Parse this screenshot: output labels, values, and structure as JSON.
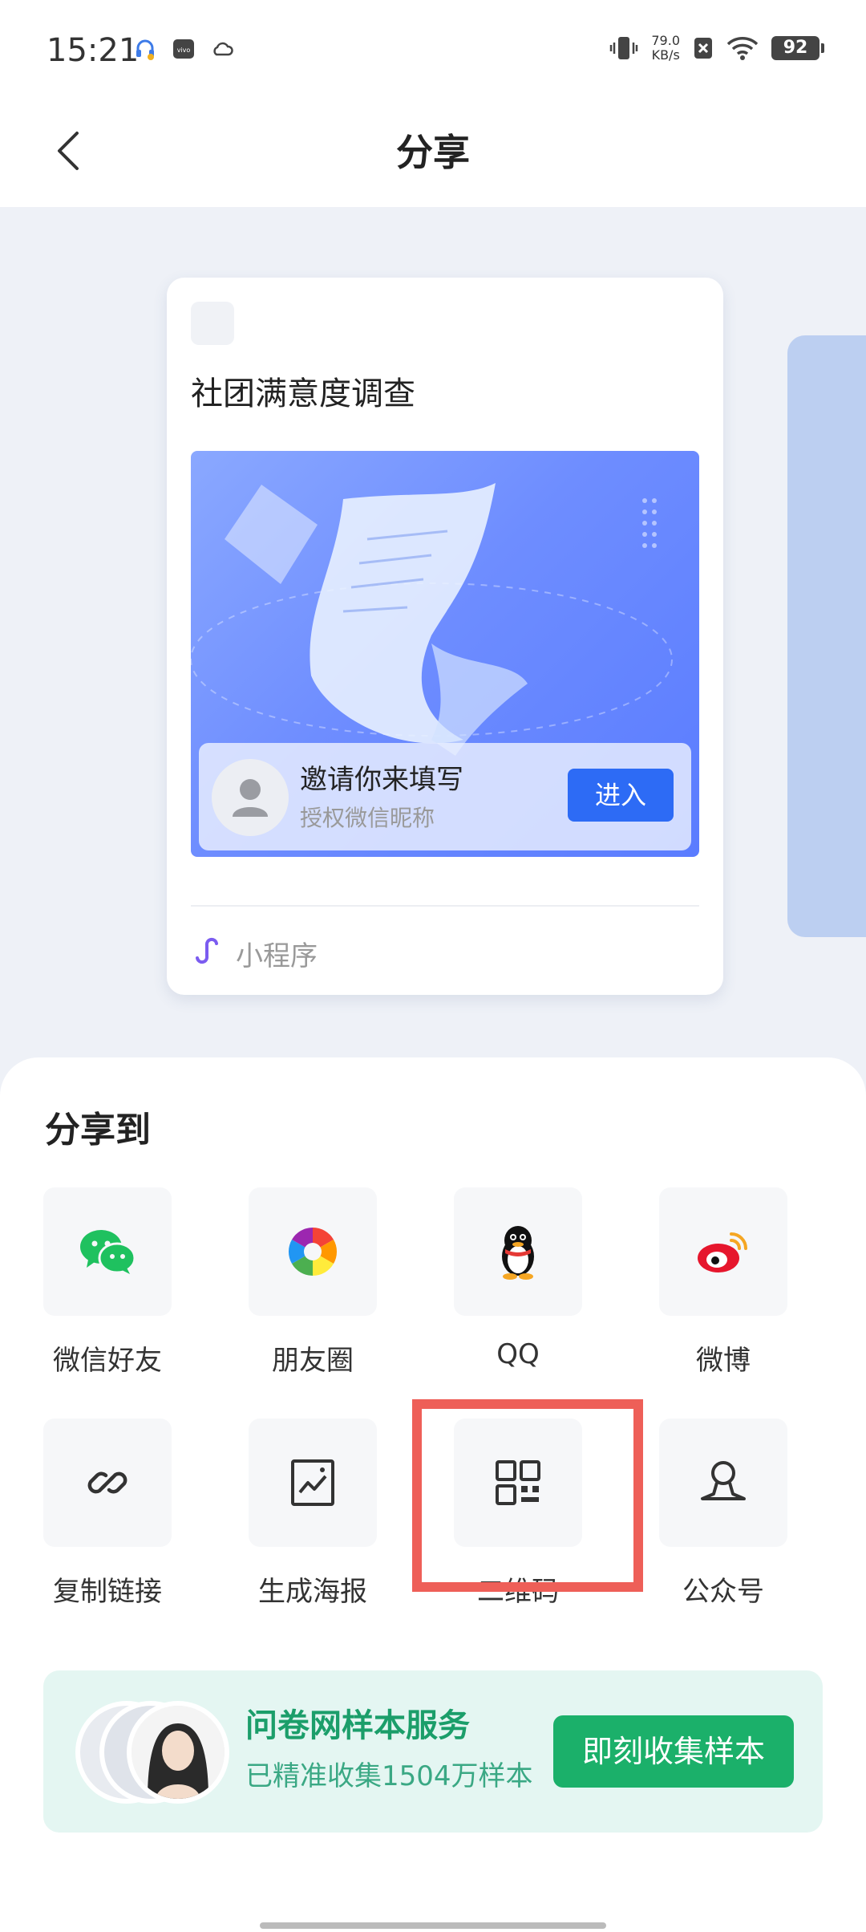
{
  "status_bar": {
    "time": "15:21",
    "net_speed_value": "79.0",
    "net_speed_unit": "KB/s",
    "battery": "92",
    "icons": [
      "headset-icon",
      "vivo-icon",
      "cloud-icon",
      "vibrate-icon",
      "no-sim-icon",
      "wifi-icon"
    ]
  },
  "header": {
    "title": "分享",
    "back_icon": "chevron-left-icon"
  },
  "preview_card": {
    "title": "社团满意度调查",
    "invite_title": "邀请你来填写",
    "invite_subtitle": "授权微信昵称",
    "enter_label": "进入",
    "footer_label": "小程序"
  },
  "share_sheet": {
    "title": "分享到",
    "items": [
      {
        "label": "微信好友",
        "icon": "wechat-icon"
      },
      {
        "label": "朋友圈",
        "icon": "moments-icon"
      },
      {
        "label": "QQ",
        "icon": "qq-icon"
      },
      {
        "label": "微博",
        "icon": "weibo-icon"
      },
      {
        "label": "复制链接",
        "icon": "link-icon"
      },
      {
        "label": "生成海报",
        "icon": "poster-icon"
      },
      {
        "label": "二维码",
        "icon": "qrcode-icon"
      },
      {
        "label": "公众号",
        "icon": "official-account-icon"
      }
    ]
  },
  "promo": {
    "title": "问卷网样本服务",
    "subtitle": "已精准收集1504万样本",
    "button": "即刻收集样本"
  },
  "colors": {
    "primary_blue": "#2d6bf5",
    "promo_green": "#1bb06a",
    "highlight_red": "#ee5f58"
  }
}
